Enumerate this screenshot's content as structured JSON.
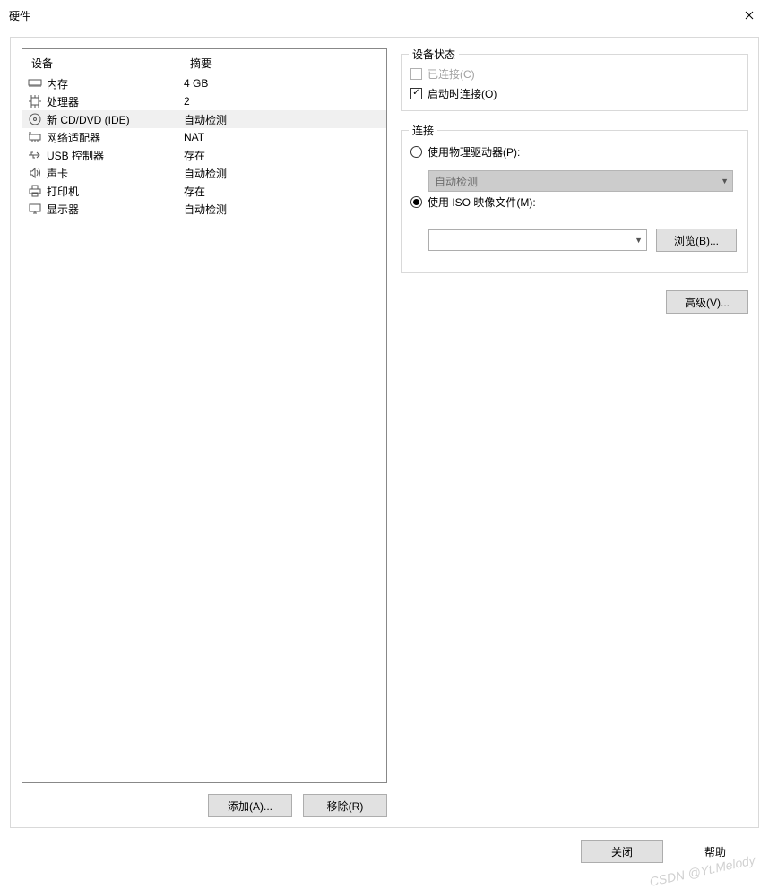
{
  "window": {
    "title": "硬件"
  },
  "device_table": {
    "header_device": "设备",
    "header_summary": "摘要",
    "rows": [
      {
        "icon": "memory",
        "name": "内存",
        "summary": "4 GB",
        "selected": false
      },
      {
        "icon": "cpu",
        "name": "处理器",
        "summary": "2",
        "selected": false
      },
      {
        "icon": "disc",
        "name": "新 CD/DVD (IDE)",
        "summary": "自动检测",
        "selected": true
      },
      {
        "icon": "network",
        "name": "网络适配器",
        "summary": "NAT",
        "selected": false
      },
      {
        "icon": "usb",
        "name": "USB 控制器",
        "summary": "存在",
        "selected": false
      },
      {
        "icon": "sound",
        "name": "声卡",
        "summary": "自动检测",
        "selected": false
      },
      {
        "icon": "printer",
        "name": "打印机",
        "summary": "存在",
        "selected": false
      },
      {
        "icon": "display",
        "name": "显示器",
        "summary": "自动检测",
        "selected": false
      }
    ]
  },
  "buttons": {
    "add": "添加(A)...",
    "remove": "移除(R)",
    "browse": "浏览(B)...",
    "advanced": "高级(V)...",
    "close": "关闭",
    "help": "帮助"
  },
  "status_group": {
    "legend": "设备状态",
    "connected_label": "已连接(C)",
    "connected_checked": false,
    "connected_enabled": false,
    "connect_at_poweron_label": "启动时连接(O)",
    "connect_at_poweron_checked": true
  },
  "connection_group": {
    "legend": "连接",
    "physical_label": "使用物理驱动器(P):",
    "physical_selected": false,
    "physical_combo_value": "自动检测",
    "iso_label": "使用 ISO 映像文件(M):",
    "iso_selected": true,
    "iso_combo_value": ""
  },
  "watermark": "CSDN @Yt.Melody"
}
